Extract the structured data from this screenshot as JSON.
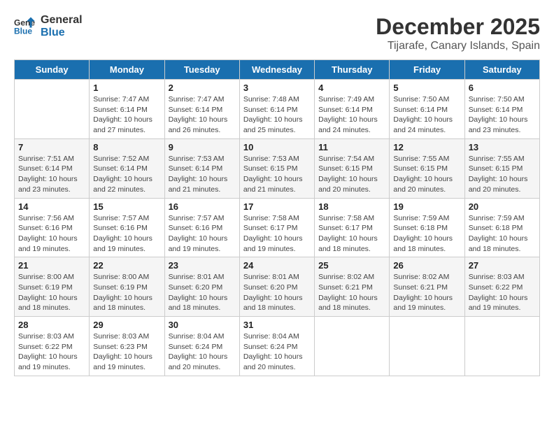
{
  "header": {
    "logo_line1": "General",
    "logo_line2": "Blue",
    "title": "December 2025",
    "subtitle": "Tijarafe, Canary Islands, Spain"
  },
  "columns": [
    "Sunday",
    "Monday",
    "Tuesday",
    "Wednesday",
    "Thursday",
    "Friday",
    "Saturday"
  ],
  "weeks": [
    [
      {
        "day": "",
        "info": ""
      },
      {
        "day": "1",
        "info": "Sunrise: 7:47 AM\nSunset: 6:14 PM\nDaylight: 10 hours\nand 27 minutes."
      },
      {
        "day": "2",
        "info": "Sunrise: 7:47 AM\nSunset: 6:14 PM\nDaylight: 10 hours\nand 26 minutes."
      },
      {
        "day": "3",
        "info": "Sunrise: 7:48 AM\nSunset: 6:14 PM\nDaylight: 10 hours\nand 25 minutes."
      },
      {
        "day": "4",
        "info": "Sunrise: 7:49 AM\nSunset: 6:14 PM\nDaylight: 10 hours\nand 24 minutes."
      },
      {
        "day": "5",
        "info": "Sunrise: 7:50 AM\nSunset: 6:14 PM\nDaylight: 10 hours\nand 24 minutes."
      },
      {
        "day": "6",
        "info": "Sunrise: 7:50 AM\nSunset: 6:14 PM\nDaylight: 10 hours\nand 23 minutes."
      }
    ],
    [
      {
        "day": "7",
        "info": "Sunrise: 7:51 AM\nSunset: 6:14 PM\nDaylight: 10 hours\nand 23 minutes."
      },
      {
        "day": "8",
        "info": "Sunrise: 7:52 AM\nSunset: 6:14 PM\nDaylight: 10 hours\nand 22 minutes."
      },
      {
        "day": "9",
        "info": "Sunrise: 7:53 AM\nSunset: 6:14 PM\nDaylight: 10 hours\nand 21 minutes."
      },
      {
        "day": "10",
        "info": "Sunrise: 7:53 AM\nSunset: 6:15 PM\nDaylight: 10 hours\nand 21 minutes."
      },
      {
        "day": "11",
        "info": "Sunrise: 7:54 AM\nSunset: 6:15 PM\nDaylight: 10 hours\nand 20 minutes."
      },
      {
        "day": "12",
        "info": "Sunrise: 7:55 AM\nSunset: 6:15 PM\nDaylight: 10 hours\nand 20 minutes."
      },
      {
        "day": "13",
        "info": "Sunrise: 7:55 AM\nSunset: 6:15 PM\nDaylight: 10 hours\nand 20 minutes."
      }
    ],
    [
      {
        "day": "14",
        "info": "Sunrise: 7:56 AM\nSunset: 6:16 PM\nDaylight: 10 hours\nand 19 minutes."
      },
      {
        "day": "15",
        "info": "Sunrise: 7:57 AM\nSunset: 6:16 PM\nDaylight: 10 hours\nand 19 minutes."
      },
      {
        "day": "16",
        "info": "Sunrise: 7:57 AM\nSunset: 6:16 PM\nDaylight: 10 hours\nand 19 minutes."
      },
      {
        "day": "17",
        "info": "Sunrise: 7:58 AM\nSunset: 6:17 PM\nDaylight: 10 hours\nand 19 minutes."
      },
      {
        "day": "18",
        "info": "Sunrise: 7:58 AM\nSunset: 6:17 PM\nDaylight: 10 hours\nand 18 minutes."
      },
      {
        "day": "19",
        "info": "Sunrise: 7:59 AM\nSunset: 6:18 PM\nDaylight: 10 hours\nand 18 minutes."
      },
      {
        "day": "20",
        "info": "Sunrise: 7:59 AM\nSunset: 6:18 PM\nDaylight: 10 hours\nand 18 minutes."
      }
    ],
    [
      {
        "day": "21",
        "info": "Sunrise: 8:00 AM\nSunset: 6:19 PM\nDaylight: 10 hours\nand 18 minutes."
      },
      {
        "day": "22",
        "info": "Sunrise: 8:00 AM\nSunset: 6:19 PM\nDaylight: 10 hours\nand 18 minutes."
      },
      {
        "day": "23",
        "info": "Sunrise: 8:01 AM\nSunset: 6:20 PM\nDaylight: 10 hours\nand 18 minutes."
      },
      {
        "day": "24",
        "info": "Sunrise: 8:01 AM\nSunset: 6:20 PM\nDaylight: 10 hours\nand 18 minutes."
      },
      {
        "day": "25",
        "info": "Sunrise: 8:02 AM\nSunset: 6:21 PM\nDaylight: 10 hours\nand 18 minutes."
      },
      {
        "day": "26",
        "info": "Sunrise: 8:02 AM\nSunset: 6:21 PM\nDaylight: 10 hours\nand 19 minutes."
      },
      {
        "day": "27",
        "info": "Sunrise: 8:03 AM\nSunset: 6:22 PM\nDaylight: 10 hours\nand 19 minutes."
      }
    ],
    [
      {
        "day": "28",
        "info": "Sunrise: 8:03 AM\nSunset: 6:22 PM\nDaylight: 10 hours\nand 19 minutes."
      },
      {
        "day": "29",
        "info": "Sunrise: 8:03 AM\nSunset: 6:23 PM\nDaylight: 10 hours\nand 19 minutes."
      },
      {
        "day": "30",
        "info": "Sunrise: 8:04 AM\nSunset: 6:24 PM\nDaylight: 10 hours\nand 20 minutes."
      },
      {
        "day": "31",
        "info": "Sunrise: 8:04 AM\nSunset: 6:24 PM\nDaylight: 10 hours\nand 20 minutes."
      },
      {
        "day": "",
        "info": ""
      },
      {
        "day": "",
        "info": ""
      },
      {
        "day": "",
        "info": ""
      }
    ]
  ]
}
